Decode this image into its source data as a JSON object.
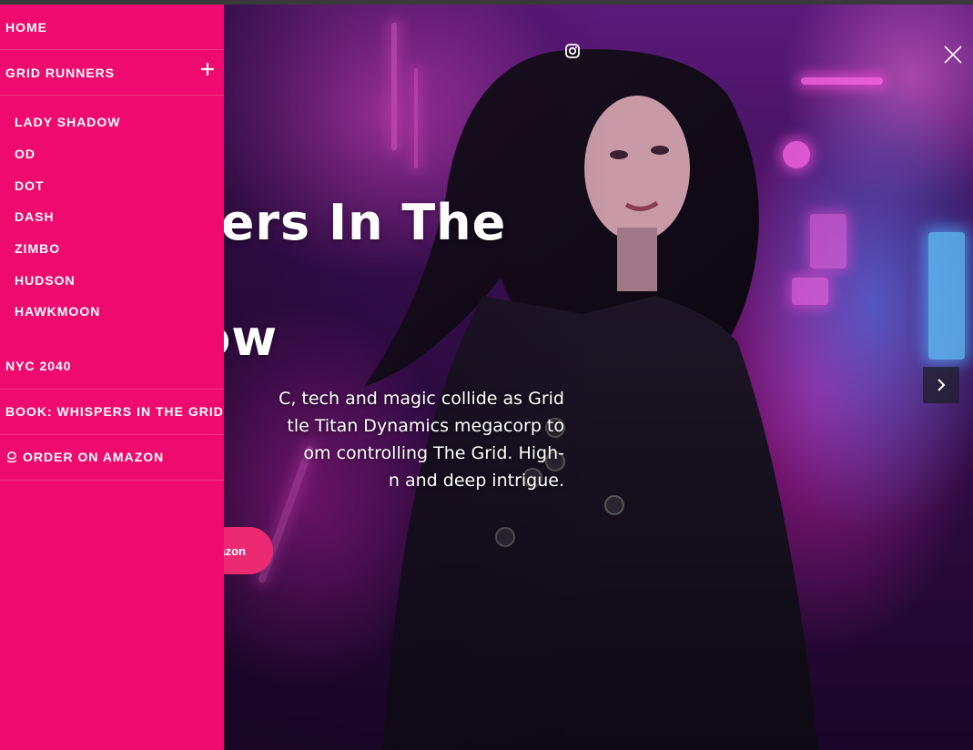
{
  "menu": {
    "home": "HOME",
    "grid_runners": "GRID RUNNERS",
    "sub_items": [
      "LADY SHADOW",
      "OD",
      "DOT",
      "DASH",
      "ZIMBO",
      "HUDSON",
      "HAWKMOON"
    ],
    "nyc": "NYC 2040",
    "book": "BOOK: WHISPERS IN THE GRID",
    "amazon": "ORDER ON AMAZON"
  },
  "hero": {
    "headline_line1": "spers In The",
    "headline_line2": "Now",
    "paragraph": [
      "C, tech and magic collide as Grid",
      "tle Titan Dynamics megacorp to",
      "om controlling The Grid. High-",
      "n and deep intrigue."
    ],
    "cta_label": "azon"
  },
  "colors": {
    "menu_bg": "#ee0a6e",
    "cta_bg": "#ec2a72"
  }
}
